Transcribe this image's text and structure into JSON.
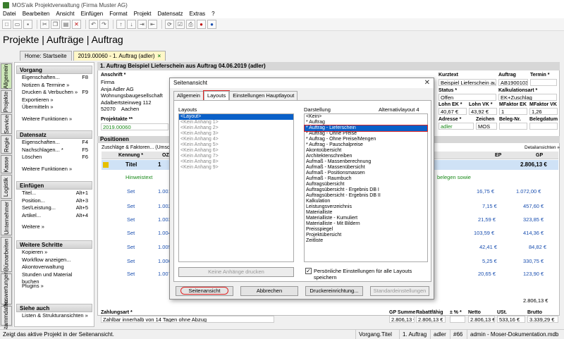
{
  "window": {
    "title": "MOS'aik Projektverwaltung (Firma Muster AG)"
  },
  "menu": [
    "Datei",
    "Bearbeiten",
    "Ansicht",
    "Einfügen",
    "Format",
    "Projekt",
    "Datensatz",
    "Extras",
    "?"
  ],
  "page_title": "Projekte | Aufträge | Auftrag",
  "tabs": [
    {
      "label": "Home: Startseite"
    },
    {
      "label": "2019.00060 - 1. Auftrag (adler)",
      "close": "×"
    }
  ],
  "vtabs": [
    "Allgemein",
    "Projekte",
    "Service",
    "Regie",
    "Kasse",
    "Logistik",
    "Unternehmer",
    "Büroarbeiten",
    "Auswertungen",
    "Stammdaten"
  ],
  "left_panel": {
    "groups": [
      {
        "title": "Vorgang",
        "items": [
          {
            "label": "Eigenschaften...",
            "key": "F8"
          },
          {
            "label": "Notizen & Termine »",
            "key": ""
          },
          {
            "label": "Drucken & Verbuchen »",
            "key": "F9"
          },
          {
            "label": "Exportieren »",
            "key": ""
          },
          {
            "label": "Übermitteln »",
            "key": ""
          }
        ],
        "more": "Weitere Funktionen »"
      },
      {
        "title": "Datensatz",
        "items": [
          {
            "label": "Eigenschaften...",
            "key": "F4"
          },
          {
            "label": "Nachschlagen... *",
            "key": "F5"
          },
          {
            "label": "Löschen",
            "key": "F6"
          }
        ],
        "more": "Weitere Funktionen »"
      },
      {
        "title": "Einfügen",
        "items": [
          {
            "label": "Titel...",
            "key": "Alt+1"
          },
          {
            "label": "Position...",
            "key": "Alt+3"
          },
          {
            "label": "Set/Leistung...",
            "key": "Alt+5"
          },
          {
            "label": "Artikel...",
            "key": "Alt+4"
          }
        ],
        "more": "Weitere »"
      },
      {
        "title": "Weitere Schritte",
        "items": [
          {
            "label": "Kopieren »",
            "key": ""
          },
          {
            "label": "Workflow anzeigen...",
            "key": ""
          },
          {
            "label": "Akontoverwaltung",
            "key": ""
          },
          {
            "label": "Stunden und Material buchen",
            "key": ""
          }
        ],
        "more": "Plugins »"
      },
      {
        "title": "Siehe auch",
        "items": [
          {
            "label": "Listen & Strukturansichten »",
            "key": ""
          }
        ],
        "more": ""
      }
    ]
  },
  "header": {
    "title": "1. Auftrag Beispiel Lieferschein aus Auftrag 04.06.2019 (adler)",
    "anschrift_label": "Anschrift *",
    "anschrift": [
      "Firma",
      "Anja Adler AG",
      "Wohnungsbaugesellschaft",
      "Adalbertsteinweg 112"
    ],
    "plz": "52070",
    "ort": "Aachen",
    "projektakte_label": "Projektakte **",
    "projektakte": "2019.00060",
    "kurztext_label": "Kurztext",
    "kurztext": "Beispiel Lieferschein aus Au",
    "auftrag_label": "Auftrag",
    "auftrag": "AB1900103",
    "termin_label": "Termin *",
    "status_label": "Status *",
    "status": "Offen",
    "kalk_label": "Kalkulationsart *",
    "kalk": "EK+Zuschlag",
    "lohnek_label": "Lohn EK *",
    "lohnek": "40,67 €",
    "lohnvk_label": "Lohn VK *",
    "lohnvk": "43,92 €",
    "mfek_label": "MFaktor EK",
    "mfek": "1",
    "mfvk_label": "MFaktor VK",
    "mfvk": "1,26",
    "adresse_label": "Adresse *",
    "adresse": "adler",
    "zeichen_label": "Zeichen",
    "zeichen": "MOS",
    "belegnr_label": "Beleg-Nr.",
    "belegdatum_label": "Belegdatum"
  },
  "positions": {
    "title": "Positionen",
    "subbar": "Zuschläge & Faktoren... (Umschalt+F",
    "details": "Detailansichten »",
    "col_kennung": "Kennung *",
    "col_oz": "OZ",
    "col_ep": "EP",
    "col_gp": "GP",
    "titel_label": "Titel",
    "titel_oz": "1",
    "titel_gp": "2.806,13 €",
    "hinweis": "Hinweistext",
    "hinweis_tail": "belegen sowie",
    "rows": [
      {
        "kind": "Set",
        "oz": "1.001",
        "ep": "16,75 €",
        "gp": "1.072,00 €"
      },
      {
        "kind": "Set",
        "oz": "1.002",
        "ep": "7,15 €",
        "gp": "457,60 €"
      },
      {
        "kind": "Set",
        "oz": "1.003",
        "ep": "21,59 €",
        "gp": "323,85 €"
      },
      {
        "kind": "Set",
        "oz": "1.004",
        "ep": "103,59 €",
        "gp": "414,36 €"
      },
      {
        "kind": "Set",
        "oz": "1.005",
        "ep": "42,41 €",
        "gp": "84,82 €"
      },
      {
        "kind": "Set",
        "oz": "1.006",
        "ep": "5,25 €",
        "gp": "330,75 €"
      },
      {
        "kind": "Set",
        "oz": "1.007",
        "ep": "20,65 €",
        "gp": "123,90 €"
      }
    ],
    "sum_gp": "2.806,13 €"
  },
  "footer": {
    "zahlungsart_label": "Zahlungsart *",
    "zahlungsart": "Zahlbar innerhalb von 14 Tagen ohne Abzug",
    "gpsumme_label": "GP Summe",
    "gpsumme": "2.806,13 €",
    "rabatt_label": "Rabattfähig",
    "rabatt": "2.806,13 €",
    "pct_label": "± % *",
    "pct": "",
    "netto_label": "Netto",
    "netto": "2.806,13 €",
    "ust_label": "USt.",
    "ust": "533,16 €",
    "brutto_label": "Brutto",
    "brutto": "3.339,29 €"
  },
  "dialog": {
    "title": "Seitenansicht",
    "close": "✕",
    "tabs": [
      "Allgemein",
      "Layouts",
      "Einstellungen Hauptlayout"
    ],
    "layouts_label": "Layouts",
    "layouts": [
      "<Layout>",
      "<Kein Anhang 1>",
      "<Kein Anhang 2>",
      "<Kein Anhang 3>",
      "<Kein Anhang 4>",
      "<Kein Anhang 5>",
      "<Kein Anhang 6>",
      "<Kein Anhang 7>",
      "<Kein Anhang 8>",
      "<Kein Anhang 9>"
    ],
    "darstellung_label": "Darstellung",
    "alternativ": "Alternativlayout 4",
    "darstellung": [
      "<Kein>",
      "* Auftrag",
      "* Auftrag - Lieferschein",
      "* Auftrag - Ohne Preise",
      "* Auftrag - Ohne Preise/Mengen",
      "* Auftrag - Pauschalpreise",
      "Akontoübersicht",
      "Architektenschreiben",
      "Aufmaß - Massenberechnung",
      "Aufmaß - Massenübersicht",
      "Aufmaß - Positionsmassen",
      "Aufmaß - Raumbuch",
      "Auftragsübersicht",
      "Auftragsübersicht - Ergebnis DB I",
      "Auftragsübersicht - Ergebnis DB II",
      "Kalkulation",
      "Leistungsverzeichnis",
      "Materialliste",
      "Materialliste - Kumuliert",
      "Materialliste - Mit Bildern",
      "Preisspiegel",
      "Projektübersicht",
      "Zeitliste"
    ],
    "no_print_btn": "Keine Anhänge drucken",
    "checkbox_label": "Persönliche Einstellungen für alle Layouts speichern",
    "buttons": [
      "Seitenansicht",
      "Abbrechen",
      "Druckereinrichtung...",
      "Standardeinstellungen"
    ]
  },
  "status": {
    "text": "Zeigt das aktive Projekt in der Seitenansicht.",
    "cells": [
      "Vorgang.Titel",
      "1. Auftrag",
      "adler",
      "#66",
      "admin - Moser-Dokumentation.mdb"
    ]
  }
}
